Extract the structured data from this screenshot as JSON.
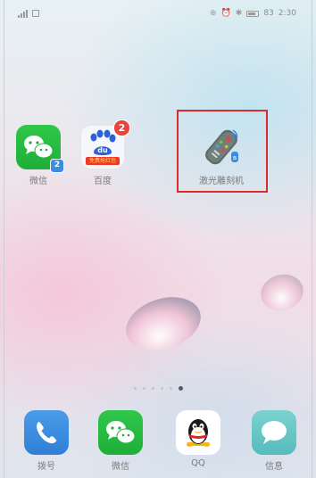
{
  "status_bar": {
    "time": "2:30",
    "battery_percent": "83"
  },
  "home_apps": [
    {
      "id": "wechat",
      "label": "微信"
    },
    {
      "id": "baidu",
      "label": "百度",
      "badge": "2",
      "banner": "免费抢红包"
    },
    {
      "id": "remote",
      "label": "激光雕刻机"
    }
  ],
  "dock_apps": [
    {
      "id": "phone",
      "label": "拨号"
    },
    {
      "id": "wechat",
      "label": "微信"
    },
    {
      "id": "qq",
      "label": "QQ"
    },
    {
      "id": "messages",
      "label": "信息"
    }
  ],
  "page_indicator": {
    "count": 6,
    "active_index": 5
  },
  "colors": {
    "highlight": "#d92c2c",
    "badge": "#e8433c",
    "wechat_green": "#2fc74a"
  }
}
